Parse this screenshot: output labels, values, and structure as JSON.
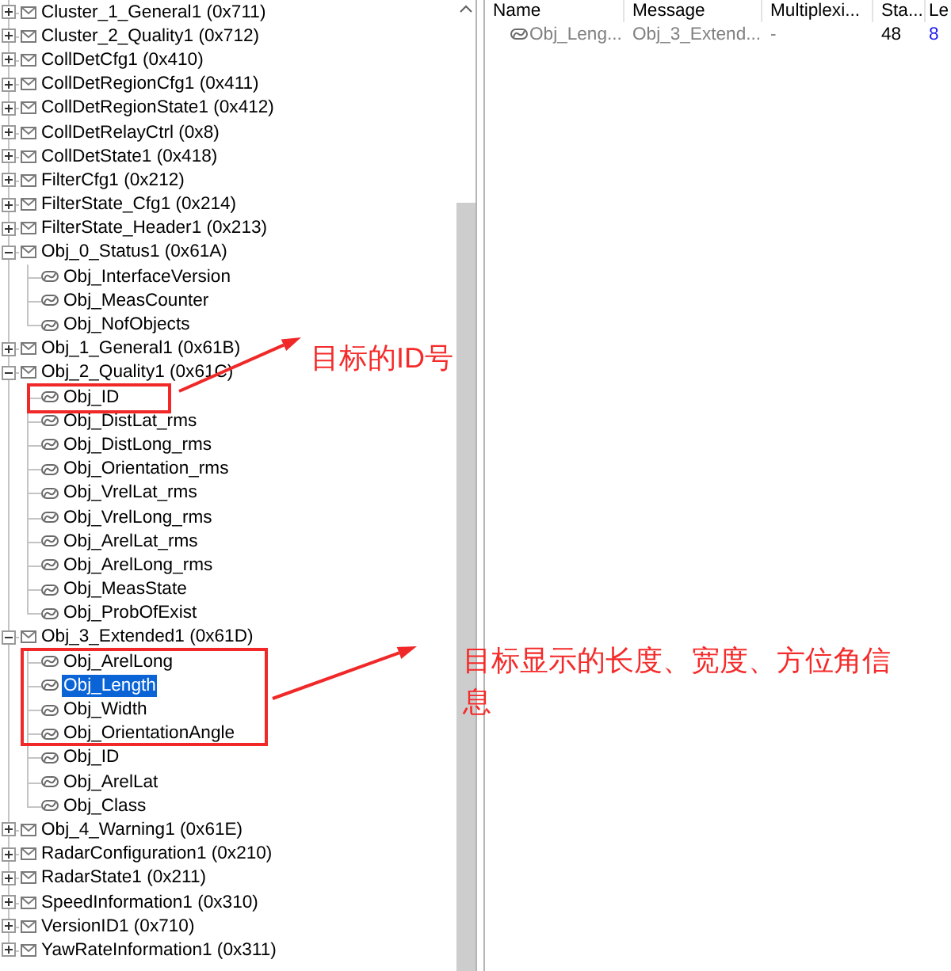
{
  "tree": {
    "items": [
      {
        "label": "Cluster_1_General1 (0x711)",
        "kind": "message",
        "expanded": false,
        "selected": false
      },
      {
        "label": "Cluster_2_Quality1 (0x712)",
        "kind": "message",
        "expanded": false,
        "selected": false
      },
      {
        "label": "CollDetCfg1 (0x410)",
        "kind": "message",
        "expanded": false,
        "selected": false
      },
      {
        "label": "CollDetRegionCfg1 (0x411)",
        "kind": "message",
        "expanded": false,
        "selected": false
      },
      {
        "label": "CollDetRegionState1 (0x412)",
        "kind": "message",
        "expanded": false,
        "selected": false
      },
      {
        "label": "CollDetRelayCtrl (0x8)",
        "kind": "message",
        "expanded": false,
        "selected": false
      },
      {
        "label": "CollDetState1 (0x418)",
        "kind": "message",
        "expanded": false,
        "selected": false
      },
      {
        "label": "FilterCfg1 (0x212)",
        "kind": "message",
        "expanded": false,
        "selected": false
      },
      {
        "label": "FilterState_Cfg1 (0x214)",
        "kind": "message",
        "expanded": false,
        "selected": false
      },
      {
        "label": "FilterState_Header1 (0x213)",
        "kind": "message",
        "expanded": false,
        "selected": false
      },
      {
        "label": "Obj_0_Status1 (0x61A)",
        "kind": "message",
        "expanded": true,
        "selected": false,
        "children": [
          {
            "label": "Obj_InterfaceVersion",
            "kind": "signal",
            "selected": false
          },
          {
            "label": "Obj_MeasCounter",
            "kind": "signal",
            "selected": false
          },
          {
            "label": "Obj_NofObjects",
            "kind": "signal",
            "selected": false
          }
        ]
      },
      {
        "label": "Obj_1_General1 (0x61B)",
        "kind": "message",
        "expanded": false,
        "selected": false
      },
      {
        "label": "Obj_2_Quality1 (0x61C)",
        "kind": "message",
        "expanded": true,
        "selected": false,
        "children": [
          {
            "label": "Obj_ID",
            "kind": "signal",
            "selected": false
          },
          {
            "label": "Obj_DistLat_rms",
            "kind": "signal",
            "selected": false
          },
          {
            "label": "Obj_DistLong_rms",
            "kind": "signal",
            "selected": false
          },
          {
            "label": "Obj_Orientation_rms",
            "kind": "signal",
            "selected": false
          },
          {
            "label": "Obj_VrelLat_rms",
            "kind": "signal",
            "selected": false
          },
          {
            "label": "Obj_VrelLong_rms",
            "kind": "signal",
            "selected": false
          },
          {
            "label": "Obj_ArelLat_rms",
            "kind": "signal",
            "selected": false
          },
          {
            "label": "Obj_ArelLong_rms",
            "kind": "signal",
            "selected": false
          },
          {
            "label": "Obj_MeasState",
            "kind": "signal",
            "selected": false
          },
          {
            "label": "Obj_ProbOfExist",
            "kind": "signal",
            "selected": false
          }
        ]
      },
      {
        "label": "Obj_3_Extended1 (0x61D)",
        "kind": "message",
        "expanded": true,
        "selected": false,
        "children": [
          {
            "label": "Obj_ArelLong",
            "kind": "signal",
            "selected": false
          },
          {
            "label": "Obj_Length",
            "kind": "signal",
            "selected": true
          },
          {
            "label": "Obj_Width",
            "kind": "signal",
            "selected": false
          },
          {
            "label": "Obj_OrientationAngle",
            "kind": "signal",
            "selected": false
          },
          {
            "label": "Obj_ID",
            "kind": "signal",
            "selected": false
          },
          {
            "label": "Obj_ArelLat",
            "kind": "signal",
            "selected": false
          },
          {
            "label": "Obj_Class",
            "kind": "signal",
            "selected": false
          }
        ]
      },
      {
        "label": "Obj_4_Warning1 (0x61E)",
        "kind": "message",
        "expanded": false,
        "selected": false
      },
      {
        "label": "RadarConfiguration1 (0x210)",
        "kind": "message",
        "expanded": false,
        "selected": false
      },
      {
        "label": "RadarState1 (0x211)",
        "kind": "message",
        "expanded": false,
        "selected": false
      },
      {
        "label": "SpeedInformation1 (0x310)",
        "kind": "message",
        "expanded": false,
        "selected": false
      },
      {
        "label": "VersionID1 (0x710)",
        "kind": "message",
        "expanded": false,
        "selected": false
      },
      {
        "label": "YawRateInformation1 (0x311)",
        "kind": "message",
        "expanded": false,
        "selected": false
      }
    ]
  },
  "table": {
    "columns": [
      "Name",
      "Message",
      "Multiplexi...",
      "Sta...",
      "Le"
    ],
    "rows": [
      {
        "kind": "signal",
        "cells": [
          "Obj_Leng...",
          "Obj_3_Extend...",
          "-",
          "48",
          "8"
        ]
      }
    ]
  },
  "annotations": [
    {
      "text": "目标的ID号"
    },
    {
      "text": "目标显示的长度、宽度、方位角信息"
    }
  ]
}
